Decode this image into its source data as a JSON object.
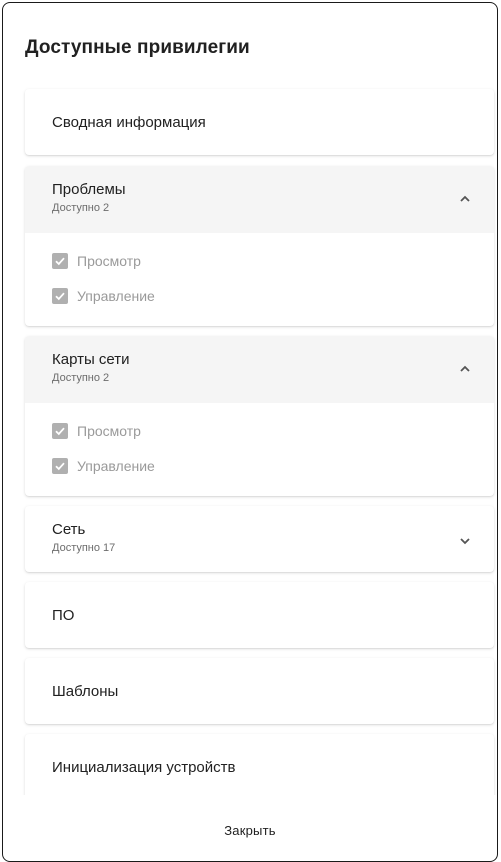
{
  "dialog": {
    "title": "Доступные привилегии",
    "close_label": "Закрыть"
  },
  "sections": [
    {
      "title": "Сводная информация"
    },
    {
      "title": "Проблемы",
      "subtitle": "Доступно 2",
      "expanded": true,
      "permissions": [
        {
          "label": "Просмотр",
          "checked": true
        },
        {
          "label": "Управление",
          "checked": true
        }
      ]
    },
    {
      "title": "Карты сети",
      "subtitle": "Доступно 2",
      "expanded": true,
      "permissions": [
        {
          "label": "Просмотр",
          "checked": true
        },
        {
          "label": "Управление",
          "checked": true
        }
      ]
    },
    {
      "title": "Сеть",
      "subtitle": "Доступно 17",
      "expanded": false
    },
    {
      "title": "ПО"
    },
    {
      "title": "Шаблоны"
    },
    {
      "title": "Инициализация устройств"
    }
  ],
  "icons": {
    "expanded": "chevron-up-icon",
    "collapsed": "chevron-down-icon",
    "checkbox": "checkbox-checked-icon"
  },
  "colors": {
    "header_expanded_bg": "#f5f5f5",
    "checkbox_disabled": "#b0b0b0",
    "border": "#1a1a1a"
  }
}
